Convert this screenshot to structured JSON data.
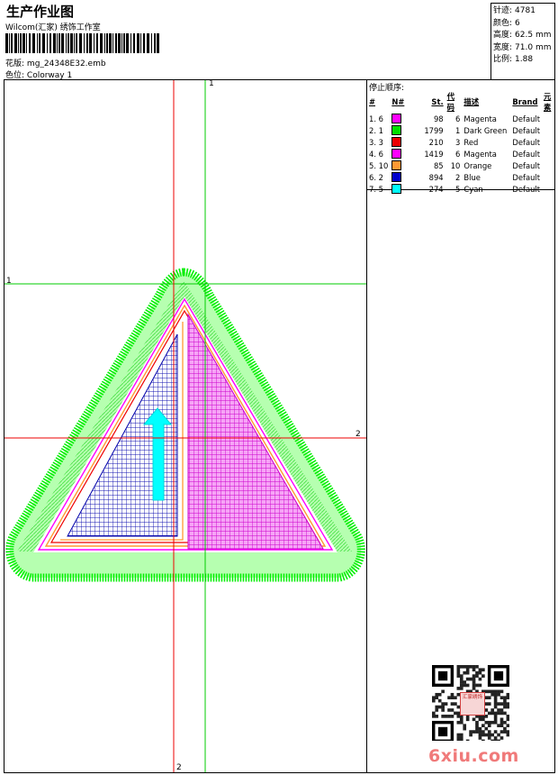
{
  "header": {
    "title": "生产作业图",
    "subtitle": "Wilcom(汇家) 绣饰工作室",
    "design_label": "花版:",
    "design_value": "mg_24348E32.emb",
    "colorway_label": "色位:",
    "colorway_value": "Colorway 1"
  },
  "info": [
    {
      "label": "针迹:",
      "value": "4781"
    },
    {
      "label": "颜色:",
      "value": "6"
    },
    {
      "label": "高度:",
      "value": "62.5 mm"
    },
    {
      "label": "宽度:",
      "value": "71.0 mm"
    },
    {
      "label": "比例:",
      "value": "1.88"
    }
  ],
  "stop_sequence": {
    "title": "停止顺序:",
    "columns": [
      "#",
      "N#",
      "St.",
      "代码",
      "描述",
      "Brand",
      "元素"
    ],
    "rows": [
      {
        "idx": "1. 6",
        "color": "#ff00ff",
        "st": "98",
        "code": "6",
        "desc": "Magenta",
        "brand": "Default"
      },
      {
        "idx": "2. 1",
        "color": "#00e000",
        "st": "1799",
        "code": "1",
        "desc": "Dark Green",
        "brand": "Default"
      },
      {
        "idx": "3. 3",
        "color": "#ee0000",
        "st": "210",
        "code": "3",
        "desc": "Red",
        "brand": "Default"
      },
      {
        "idx": "4. 6",
        "color": "#ff00ff",
        "st": "1419",
        "code": "6",
        "desc": "Magenta",
        "brand": "Default"
      },
      {
        "idx": "5. 10",
        "color": "#ff9933",
        "st": "85",
        "code": "10",
        "desc": "Orange",
        "brand": "Default"
      },
      {
        "idx": "6. 2",
        "color": "#0000cc",
        "st": "894",
        "code": "2",
        "desc": "Blue",
        "brand": "Default"
      },
      {
        "idx": "7. 5",
        "color": "#00ffff",
        "st": "274",
        "code": "5",
        "desc": "Cyan",
        "brand": "Default"
      }
    ]
  },
  "guides": {
    "green_v": "1",
    "green_h": "1",
    "red_h": "2",
    "red_v": "2"
  },
  "watermark": "6xiu.com",
  "stamp": "汇家绣饰"
}
